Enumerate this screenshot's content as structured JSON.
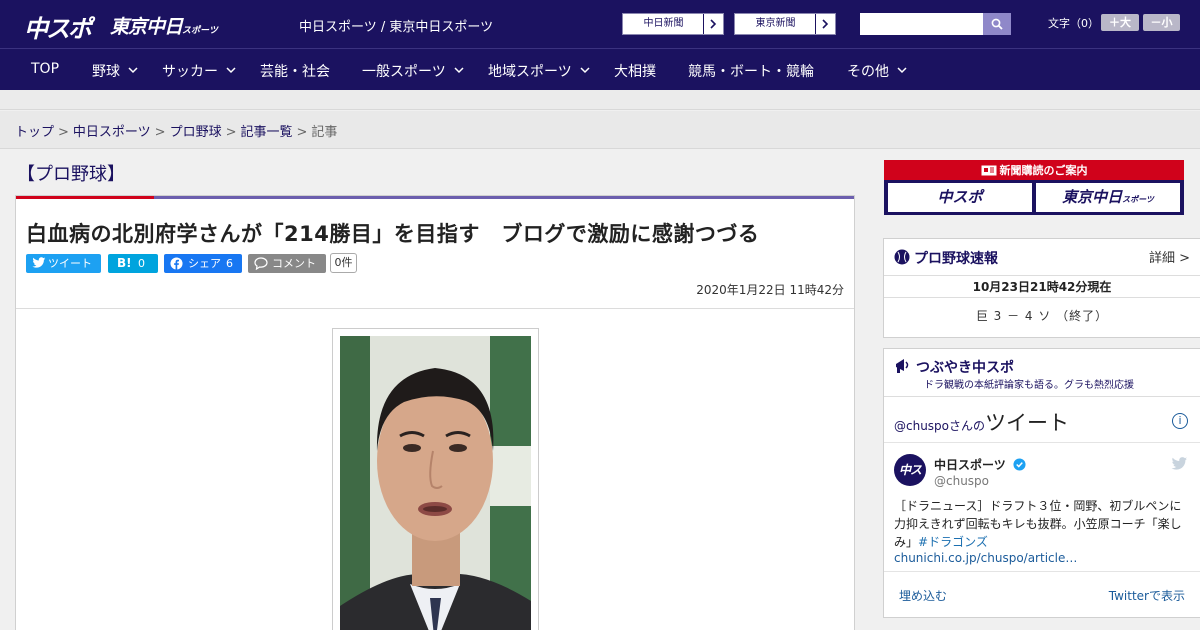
{
  "header": {
    "logo_main": "中スポ",
    "logo_sub": "東京中日",
    "logo_sub_small": "スポーツ",
    "site_title": "中日スポーツ / 東京中日スポーツ",
    "link_chunichi": "中日新聞",
    "link_tokyo": "東京新聞",
    "search": {
      "placeholder": "",
      "value": ""
    },
    "font_size_label": "文字（0）",
    "font_larger": "＋大",
    "font_smaller": "－小"
  },
  "nav": {
    "items": [
      {
        "label": "TOP",
        "has_menu": false
      },
      {
        "label": "野球",
        "has_menu": true
      },
      {
        "label": "サッカー",
        "has_menu": true
      },
      {
        "label": "芸能・社会",
        "has_menu": false
      },
      {
        "label": "一般スポーツ",
        "has_menu": true
      },
      {
        "label": "地域スポーツ",
        "has_menu": true
      },
      {
        "label": "大相撲",
        "has_menu": false
      },
      {
        "label": "競馬・ボート・競輪",
        "has_menu": false
      },
      {
        "label": "その他",
        "has_menu": true
      }
    ]
  },
  "breadcrumb": {
    "items": [
      "トップ",
      "中日スポーツ",
      "プロ野球",
      "記事一覧",
      "記事"
    ],
    "separator": ">"
  },
  "article": {
    "section": "【プロ野球】",
    "headline": "白血病の北別府学さんが「214勝目」を目指す　ブログで激励に感謝つづる",
    "share": {
      "tweet": "ツイート",
      "hatena_label": "B!",
      "hatena_count": "0",
      "facebook": "シェア",
      "facebook_count": "6",
      "comment": "コメント",
      "comment_count": "0件"
    },
    "date": "2020年1月22日 11時42分"
  },
  "sidebar": {
    "banner": {
      "title": "新聞購読のご案内",
      "left": "中スポ",
      "right": "東京中日",
      "right_small": "スポーツ"
    },
    "scores": {
      "title": "プロ野球速報",
      "more": "詳細 >",
      "timestamp": "10月23日21時42分現在",
      "game": "巨 3 － 4 ソ （終了）"
    },
    "tweets": {
      "title": "つぶやき中スポ",
      "subtitle": "ドラ観戦の本紙評論家も語る。グラも熱烈応援",
      "header_handle": "@chuspo",
      "header_suffix": "さんの",
      "header_big": "ツイート",
      "info": "i",
      "avatar_text": "中スポ",
      "name": "中日スポーツ",
      "handle": "@chuspo",
      "text": "［ドラニュース］ドラフト３位・岡野、初ブルペンに力抑えきれず回転もキレも抜群。小笠原コーチ「楽しみ」",
      "hashtag": "#ドラゴンズ",
      "link": "chunichi.co.jp/chuspo/article…",
      "embed": "埋め込む",
      "view": "Twitterで表示"
    }
  },
  "colors": {
    "brand_navy": "#1b1260",
    "accent_red": "#d0021b",
    "accent_purple": "#6c5fae",
    "twitter_blue": "#1da1f2",
    "hatena_blue": "#00a4de",
    "facebook_blue": "#1877f2"
  }
}
